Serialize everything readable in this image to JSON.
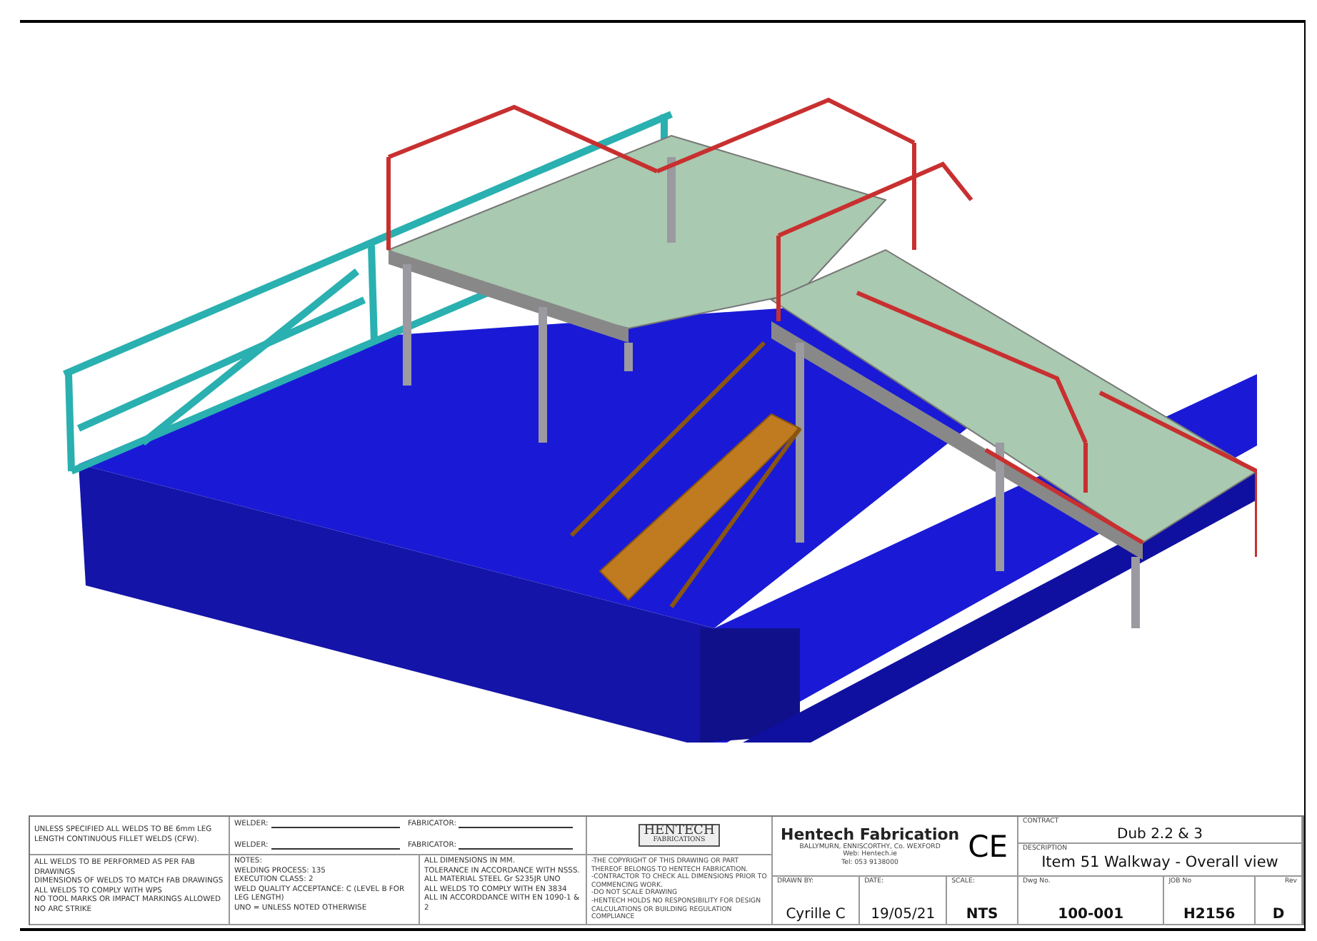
{
  "title_block": {
    "weld_spec": "UNLESS SPECIFIED ALL WELDS TO BE 6mm LEG LENGTH CONTINUOUS FILLET WELDS (CFW).",
    "signoffs": [
      {
        "label": "WELDER:"
      },
      {
        "label": "FABRICATOR:"
      },
      {
        "label": "WELDER:"
      },
      {
        "label": "FABRICATOR:"
      }
    ],
    "weld_rules": [
      "ALL WELDS TO BE PERFORMED AS PER FAB DRAWINGS",
      "DIMENSIONS OF WELDS TO MATCH FAB DRAWINGS",
      "ALL WELDS TO COMPLY WITH WPS",
      "NO TOOL MARKS OR IMPACT MARKINGS ALLOWED",
      "NO ARC STRIKE"
    ],
    "notes": [
      "NOTES:",
      "WELDING PROCESS: 135",
      "EXECUTION CLASS: 2",
      "WELD QUALITY ACCEPTANCE: C (LEVEL B FOR LEG LENGTH)",
      "UNO = UNLESS NOTED OTHERWISE"
    ],
    "general": [
      "ALL DIMENSIONS IN MM.",
      "TOLERANCE IN ACCORDANCE WITH NSSS.",
      "ALL MATERIAL STEEL Gr S235JR UNO",
      "ALL WELDS TO COMPLY WITH EN 3834",
      "ALL IN ACCORDDANCE WITH EN 1090-1 & 2"
    ],
    "logo_text": [
      "HENTECH",
      "FABRICATIONS"
    ],
    "copyright": [
      "-THE COPYRIGHT OF THIS DRAWING OR PART THEREOF BELONGS TO HENTECH FABRICATION.",
      "-CONTRACTOR TO CHECK ALL DIMENSIONS PRIOR TO COMMENCING WORK.",
      "-DO NOT SCALE DRAWING",
      "-HENTECH HOLDS NO RESPONSIBILITY FOR DESIGN CALCULATIONS OR BUILDING REGULATION COMPLIANCE"
    ],
    "company": "Hentech Fabrication",
    "address": [
      "BALLYMURN, ENNISCORTHY, Co. WEXFORD",
      "Web: Hentech.ie",
      "Tel: 053 9138000"
    ],
    "mark": "CE",
    "fields": [
      {
        "label": "DRAWN BY:",
        "value": "Cyrille C"
      },
      {
        "label": "DATE:",
        "value": "19/05/21"
      },
      {
        "label": "SCALE:",
        "value": "NTS"
      }
    ],
    "contract": {
      "label": "CONTRACT",
      "value": "Dub 2.2 & 3"
    },
    "description": {
      "label": "DESCRIPTION",
      "value": "Item 51 Walkway - Overall view"
    },
    "ids": [
      {
        "label": "Dwg No.",
        "value": "100-001"
      },
      {
        "label": "JOB No",
        "value": "H2156"
      },
      {
        "label": "Rev",
        "value": "D"
      }
    ]
  }
}
